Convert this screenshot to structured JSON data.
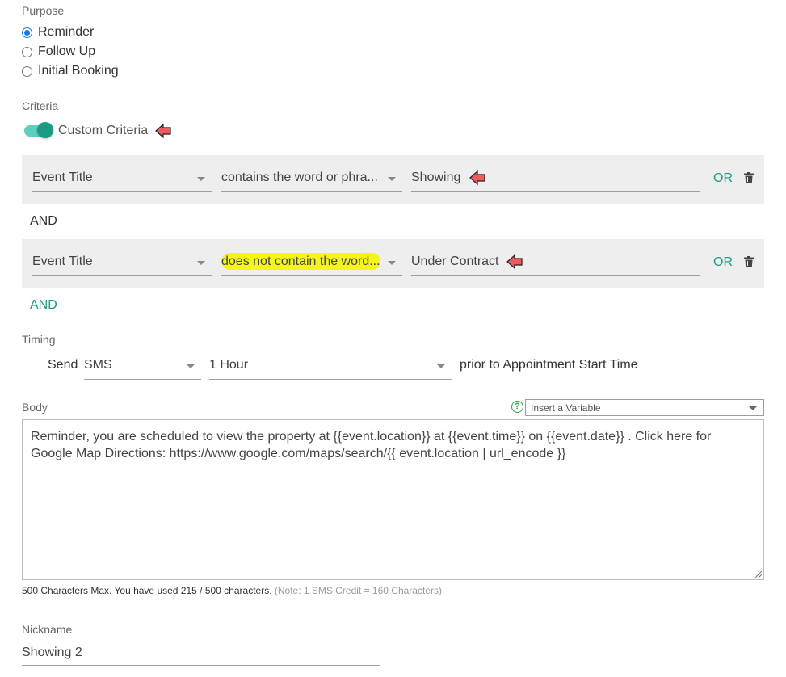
{
  "purpose": {
    "label": "Purpose",
    "options": [
      {
        "label": "Reminder",
        "checked": true
      },
      {
        "label": "Follow Up",
        "checked": false
      },
      {
        "label": "Initial Booking",
        "checked": false
      }
    ]
  },
  "criteria": {
    "label": "Criteria",
    "toggle_label": "Custom Criteria",
    "toggle_on": true,
    "rules": [
      {
        "field": "Event Title",
        "operator": "contains the word or phra...",
        "value": "Showing",
        "or_label": "OR"
      },
      {
        "field": "Event Title",
        "operator": "does not contain the word...",
        "value": "Under Contract",
        "or_label": "OR"
      }
    ],
    "and_label": "AND",
    "add_and_label": "AND"
  },
  "timing": {
    "label": "Timing",
    "send_label": "Send",
    "channel": "SMS",
    "offset": "1 Hour",
    "suffix": "prior to Appointment Start Time"
  },
  "body": {
    "label": "Body",
    "variable_placeholder": "Insert a Variable",
    "text": "Reminder, you are scheduled to view the property at {{event.location}} at {{event.time}} on {{event.date}} . Click here for Google Map Directions: https://www.google.com/maps/search/{{ event.location | url_encode }}",
    "char_info": "500 Characters Max. You have used 215 / 500 characters.",
    "char_note": "(Note: 1 SMS Credit = 160 Characters)"
  },
  "nickname": {
    "label": "Nickname",
    "value": "Showing 2"
  },
  "colors": {
    "accent": "#1a9b86",
    "arrow": "#f05a5a",
    "highlight": "#f4f51a"
  }
}
